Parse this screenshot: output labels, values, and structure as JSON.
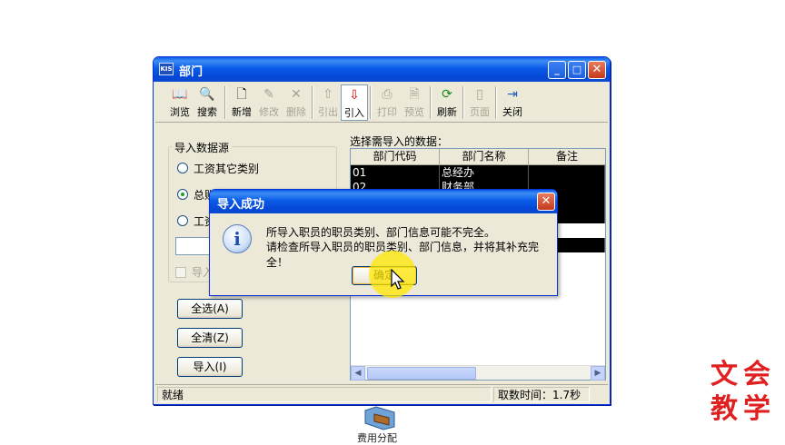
{
  "window": {
    "app_badge": "KIS",
    "title": "部门",
    "controls": {
      "minimize": "_",
      "maximize": "□",
      "close": "✕"
    }
  },
  "toolbar": [
    {
      "label": "浏览",
      "icon": "book-icon",
      "glyph": "📖",
      "enabled": true
    },
    {
      "label": "搜索",
      "icon": "search-icon",
      "glyph": "🔍",
      "enabled": true
    },
    {
      "label": "新增",
      "icon": "new-doc-icon",
      "glyph": "🗋",
      "enabled": true
    },
    {
      "label": "修改",
      "icon": "edit-icon",
      "glyph": "✎",
      "enabled": false
    },
    {
      "label": "删除",
      "icon": "delete-icon",
      "glyph": "✕",
      "enabled": false
    },
    {
      "label": "引出",
      "icon": "export-icon",
      "glyph": "⇧",
      "enabled": false
    },
    {
      "label": "引入",
      "icon": "import-icon",
      "glyph": "⇩",
      "enabled": true
    },
    {
      "label": "打印",
      "icon": "print-icon",
      "glyph": "⎙",
      "enabled": false
    },
    {
      "label": "预览",
      "icon": "preview-icon",
      "glyph": "🗎",
      "enabled": false
    },
    {
      "label": "刷新",
      "icon": "refresh-icon",
      "glyph": "⟳",
      "enabled": true
    },
    {
      "label": "页面",
      "icon": "page-icon",
      "glyph": "▯",
      "enabled": false
    },
    {
      "label": "关闭",
      "icon": "exit-icon",
      "glyph": "⇥",
      "enabled": true
    }
  ],
  "source": {
    "label": "导入数据源",
    "options": [
      "工资其它类别",
      "总账",
      "工资"
    ],
    "selected_index": 1,
    "checkbox_label": "导入"
  },
  "buttons": {
    "select_all": "全选(A)",
    "clear_all": "全清(Z)",
    "import": "导入(I)"
  },
  "list": {
    "label": "选择需导入的数据：",
    "columns": [
      "部门代码",
      "部门名称",
      "备注"
    ],
    "rows": [
      [
        "01",
        "总经办",
        ""
      ],
      [
        "02",
        "财务部",
        ""
      ],
      [
        "",
        "",
        ""
      ],
      [
        "",
        "",
        ""
      ],
      [
        "",
        "",
        ""
      ],
      [
        "",
        "",
        ""
      ]
    ]
  },
  "status": {
    "left": "就绪",
    "right": "取数时间：1.7秒"
  },
  "dialog": {
    "title": "导入成功",
    "close": "✕",
    "line1": "所导入职员的职员类别、部门信息可能不完全。",
    "line2": "请检查所导入职员的职员类别、部门信息，并将其补充完全！",
    "ok": "确定",
    "icon_glyph": "i"
  },
  "desktop_icon_label": "费用分配",
  "watermark": [
    "文",
    "会",
    "教",
    "学"
  ]
}
